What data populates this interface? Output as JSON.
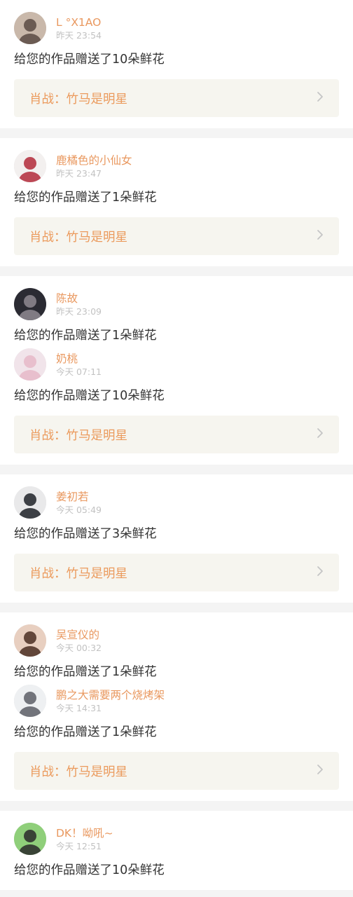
{
  "cards": [
    {
      "entries": [
        {
          "username": "L °X1AO",
          "time": "昨天 23:54",
          "message": "给您的作品赠送了10朵鲜花",
          "avatar": "avatar-two-girls-icon",
          "avatar_colors": [
            "#c9b8aa",
            "#5a4a44"
          ]
        }
      ],
      "link": {
        "title": "肖战：竹马是明星",
        "icon": "chevron-right-icon"
      }
    },
    {
      "entries": [
        {
          "username": "鹿橘色的小仙女",
          "time": "昨天 23:47",
          "message": "给您的作品赠送了1朵鲜花",
          "avatar": "avatar-girl-red-hood-icon",
          "avatar_colors": [
            "#f3f0ef",
            "#b22a3a"
          ]
        }
      ],
      "link": {
        "title": "肖战：竹马是明星",
        "icon": "chevron-right-icon"
      }
    },
    {
      "entries": [
        {
          "username": "陈故",
          "time": "昨天 23:09",
          "message": "给您的作品赠送了1朵鲜花",
          "avatar": "avatar-dark-profile-icon",
          "avatar_colors": [
            "#2b2b33",
            "#8f8a92"
          ]
        },
        {
          "username": "奶桃",
          "time": "今天 07:11",
          "message": "给您的作品赠送了10朵鲜花",
          "avatar": "avatar-pink-hair-icon",
          "avatar_colors": [
            "#f1e4ea",
            "#e6b9c8"
          ]
        }
      ],
      "link": {
        "title": "肖战：竹马是明星",
        "icon": "chevron-right-icon"
      }
    },
    {
      "entries": [
        {
          "username": "姜初若",
          "time": "今天 05:49",
          "message": "给您的作品赠送了3朵鲜花",
          "avatar": "avatar-boy-black-icon",
          "avatar_colors": [
            "#e9e9ea",
            "#1f2228"
          ]
        }
      ],
      "link": {
        "title": "肖战：竹马是明星",
        "icon": "chevron-right-icon"
      }
    },
    {
      "entries": [
        {
          "username": "吴宣仪的",
          "time": "今天 00:32",
          "message": "给您的作品赠送了1朵鲜花",
          "avatar": "avatar-girl-portrait-icon",
          "avatar_colors": [
            "#e8cfc0",
            "#4a2e22"
          ]
        },
        {
          "username": "鹏之大需要两个烧烤架",
          "time": "今天 14:31",
          "message": "给您的作品赠送了1朵鲜花",
          "avatar": "avatar-rabbit-icon",
          "avatar_colors": [
            "#eef0f2",
            "#5c5e66"
          ]
        }
      ],
      "link": {
        "title": "肖战：竹马是明星",
        "icon": "chevron-right-icon"
      }
    },
    {
      "entries": [
        {
          "username": "DK！呦吼~",
          "time": "今天 12:51",
          "message": "给您的作品赠送了10朵鲜花",
          "avatar": "avatar-cartoon-girl-icon",
          "avatar_colors": [
            "#8fcf7a",
            "#2a2a2a"
          ]
        }
      ],
      "link": null
    }
  ],
  "colors": {
    "username": "#e9985f",
    "time": "#c2c2c2",
    "message": "#333333",
    "link_bg": "#f6f5ef",
    "link_text": "#eb9a5c",
    "chevron": "#c5c5c5",
    "separator": "#f4f4f4"
  }
}
